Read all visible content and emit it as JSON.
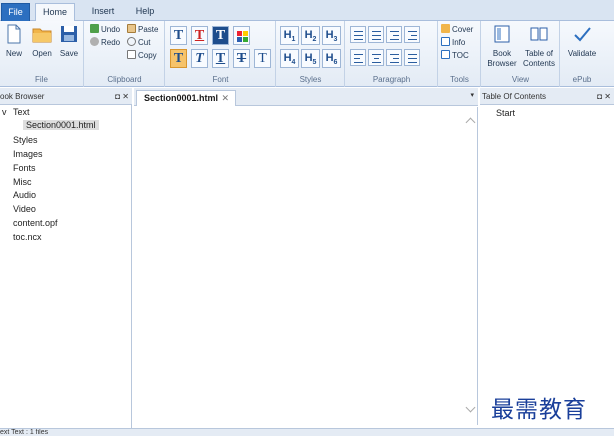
{
  "tabs": {
    "file": "File",
    "home": "Home",
    "insert": "Insert",
    "help": "Help"
  },
  "ribbon": {
    "file_group": {
      "label": "File",
      "new": "New",
      "open": "Open",
      "save": "Save"
    },
    "clipboard_group": {
      "label": "Clipboard",
      "undo": "Undo",
      "redo": "Redo",
      "paste": "Paste",
      "cut": "Cut",
      "copy": "Copy"
    },
    "font_group": {
      "label": "Font"
    },
    "styles_group": {
      "label": "Styles"
    },
    "paragraph_group": {
      "label": "Paragraph"
    },
    "tools_group": {
      "label": "Tools",
      "cover": "Cover",
      "info": "Info",
      "toc": "TOC"
    },
    "view_group": {
      "label": "View",
      "book_browser_1": "Book",
      "book_browser_2": "Browser",
      "toc_1": "Table of",
      "toc_2": "Contents"
    },
    "epub_group": {
      "label": "ePub",
      "validate": "Validate"
    },
    "colors": {
      "accent": "#2c6fc0",
      "active": "#f6c36a",
      "icon_blue": "#1e4d8c"
    }
  },
  "book_browser": {
    "title": "ook Browser",
    "controls": "◘ ✕",
    "tree": {
      "expander": "v",
      "text": "Text",
      "section": "Section0001.html",
      "styles": "Styles",
      "images": "Images",
      "fonts": "Fonts",
      "misc": "Misc",
      "audio": "Audio",
      "video": "Video",
      "content_opf": "content.opf",
      "toc_ncx": "toc.ncx"
    }
  },
  "editor": {
    "tab_label": "Section0001.html",
    "tab_close": "✕",
    "menu": "▾"
  },
  "toc_panel": {
    "title": "Table Of Contents",
    "controls": "◘ ✕",
    "start": "Start"
  },
  "watermark": "最需教育",
  "status": "ext   Text : 1 files"
}
